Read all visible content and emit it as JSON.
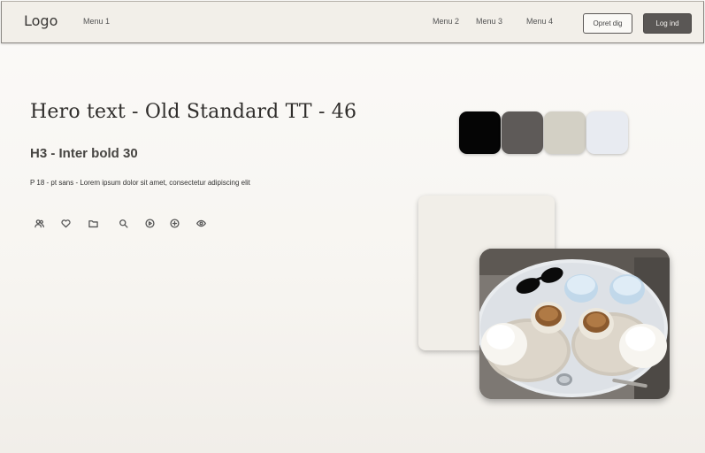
{
  "header": {
    "logo": "Logo",
    "menu": [
      "Menu 1",
      "Menu 2",
      "Menu 3",
      "Menu 4"
    ],
    "signup_label": "Opret dig",
    "login_label": "Log ind"
  },
  "main": {
    "hero_text": "Hero text - Old Standard TT - 46",
    "h3_text": "H3 - Inter bold 30",
    "paragraph": "P 18 - pt sans - Lorem ipsum dolor sit amet, consectetur adipiscing elit",
    "icons": [
      "users-icon",
      "heart-icon",
      "folder-icon",
      "search-icon",
      "play-circle-icon",
      "plus-circle-icon",
      "eye-icon"
    ]
  },
  "palette": {
    "colors": [
      "#050505",
      "#5e5a58",
      "#d3d0c5",
      "#e8ebf1"
    ]
  },
  "photo": {
    "description_icon": "cafe-table-photo"
  }
}
